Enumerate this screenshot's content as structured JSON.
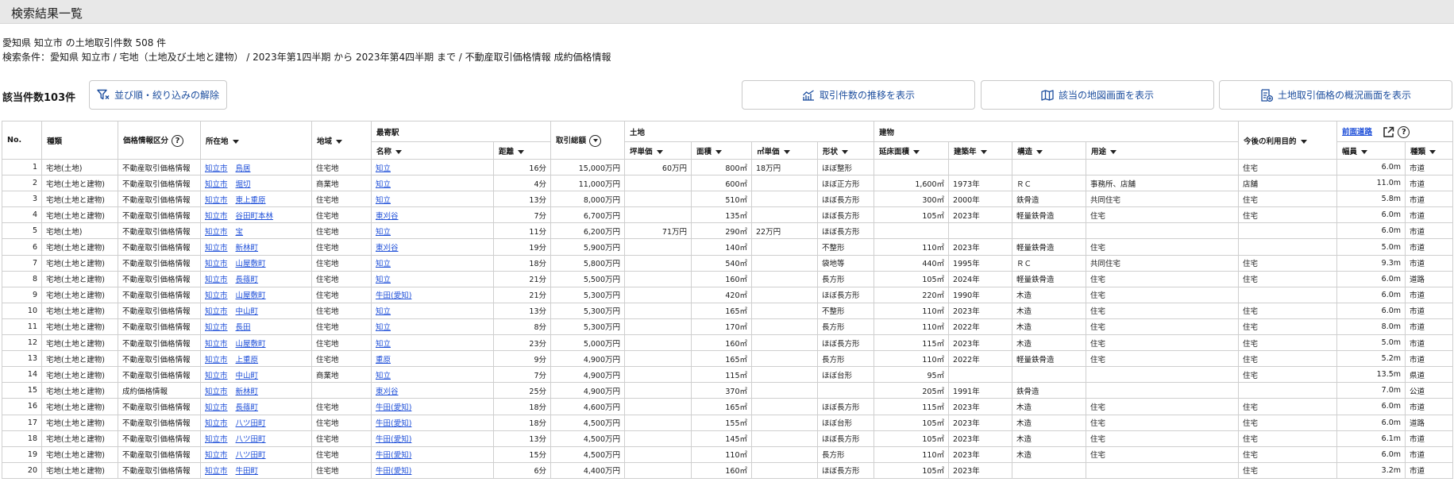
{
  "page": {
    "title": "検索結果一覧"
  },
  "summary": {
    "line1": "愛知県 知立市 の土地取引件数 508 件",
    "line2": "検索条件：愛知県 知立市 / 宅地（土地及び土地と建物） / 2023年第1四半期 から 2023年第4四半期 まで / 不動産取引価格情報 成約価格情報"
  },
  "toolbar": {
    "hit_count": "該当件数103件",
    "reset_label": "並び順・絞り込みの解除",
    "trend_label": "取引件数の推移を表示",
    "map_label": "該当の地図画面を表示",
    "overview_label": "土地取引価格の概況画面を表示"
  },
  "colors": {
    "link": "#1d4ed8",
    "button_text": "#1d4e9e",
    "header_bg": "#e8e8e8",
    "border": "#cfcfcf"
  },
  "table": {
    "groups": {
      "station": "最寄駅",
      "land": "土地",
      "building": "建物",
      "road_link": "前面道路"
    },
    "headers": {
      "no": "No.",
      "kind": "種類",
      "price_cat": "価格情報区分",
      "location": "所在地",
      "area": "地域",
      "station_name": "名称",
      "distance": "距離",
      "total": "取引総額",
      "tsubo": "坪単価",
      "land_area": "面積",
      "sqm": "㎡単価",
      "shape": "形状",
      "floor_area": "延床面積",
      "year": "建築年",
      "structure": "構造",
      "use": "用途",
      "future": "今後の利用目的",
      "width": "幅員",
      "road_kind": "種類"
    },
    "rows": [
      {
        "no": "1",
        "kind": "宅地(土地)",
        "cat": "不動産取引価格情報",
        "city": "知立市",
        "town": "鳥居",
        "area": "住宅地",
        "station": "知立",
        "dist": "16分",
        "total": "15,000万円",
        "tsubo": "60万円",
        "land": "800㎡",
        "sqm": "18万円",
        "shape": "ほぼ整形",
        "floor": "",
        "year": "",
        "struct": "",
        "use": "",
        "future": "住宅",
        "width": "6.0m",
        "road": "市道"
      },
      {
        "no": "2",
        "kind": "宅地(土地と建物)",
        "cat": "不動産取引価格情報",
        "city": "知立市",
        "town": "堀切",
        "area": "商業地",
        "station": "知立",
        "dist": "4分",
        "total": "11,000万円",
        "tsubo": "",
        "land": "600㎡",
        "sqm": "",
        "shape": "ほぼ正方形",
        "floor": "1,600㎡",
        "year": "1973年",
        "struct": "ＲＣ",
        "use": "事務所、店舗",
        "future": "店舗",
        "width": "11.0m",
        "road": "市道"
      },
      {
        "no": "3",
        "kind": "宅地(土地と建物)",
        "cat": "不動産取引価格情報",
        "city": "知立市",
        "town": "東上重原",
        "area": "住宅地",
        "station": "知立",
        "dist": "13分",
        "total": "8,000万円",
        "tsubo": "",
        "land": "510㎡",
        "sqm": "",
        "shape": "ほぼ長方形",
        "floor": "300㎡",
        "year": "2000年",
        "struct": "鉄骨造",
        "use": "共同住宅",
        "future": "住宅",
        "width": "5.8m",
        "road": "市道"
      },
      {
        "no": "4",
        "kind": "宅地(土地と建物)",
        "cat": "不動産取引価格情報",
        "city": "知立市",
        "town": "谷田町本林",
        "area": "住宅地",
        "station": "東刈谷",
        "dist": "7分",
        "total": "6,700万円",
        "tsubo": "",
        "land": "135㎡",
        "sqm": "",
        "shape": "ほぼ長方形",
        "floor": "105㎡",
        "year": "2023年",
        "struct": "軽量鉄骨造",
        "use": "住宅",
        "future": "住宅",
        "width": "6.0m",
        "road": "市道"
      },
      {
        "no": "5",
        "kind": "宅地(土地)",
        "cat": "不動産取引価格情報",
        "city": "知立市",
        "town": "宝",
        "area": "住宅地",
        "station": "知立",
        "dist": "11分",
        "total": "6,200万円",
        "tsubo": "71万円",
        "land": "290㎡",
        "sqm": "22万円",
        "shape": "ほぼ長方形",
        "floor": "",
        "year": "",
        "struct": "",
        "use": "",
        "future": "",
        "width": "6.0m",
        "road": "市道"
      },
      {
        "no": "6",
        "kind": "宅地(土地と建物)",
        "cat": "不動産取引価格情報",
        "city": "知立市",
        "town": "新林町",
        "area": "住宅地",
        "station": "東刈谷",
        "dist": "19分",
        "total": "5,900万円",
        "tsubo": "",
        "land": "140㎡",
        "sqm": "",
        "shape": "不整形",
        "floor": "110㎡",
        "year": "2023年",
        "struct": "軽量鉄骨造",
        "use": "住宅",
        "future": "",
        "width": "5.0m",
        "road": "市道"
      },
      {
        "no": "7",
        "kind": "宅地(土地と建物)",
        "cat": "不動産取引価格情報",
        "city": "知立市",
        "town": "山屋敷町",
        "area": "住宅地",
        "station": "知立",
        "dist": "18分",
        "total": "5,800万円",
        "tsubo": "",
        "land": "540㎡",
        "sqm": "",
        "shape": "袋地等",
        "floor": "440㎡",
        "year": "1995年",
        "struct": "ＲＣ",
        "use": "共同住宅",
        "future": "住宅",
        "width": "9.3m",
        "road": "市道"
      },
      {
        "no": "8",
        "kind": "宅地(土地と建物)",
        "cat": "不動産取引価格情報",
        "city": "知立市",
        "town": "長篠町",
        "area": "住宅地",
        "station": "知立",
        "dist": "21分",
        "total": "5,500万円",
        "tsubo": "",
        "land": "160㎡",
        "sqm": "",
        "shape": "長方形",
        "floor": "105㎡",
        "year": "2024年",
        "struct": "軽量鉄骨造",
        "use": "住宅",
        "future": "住宅",
        "width": "6.0m",
        "road": "道路"
      },
      {
        "no": "9",
        "kind": "宅地(土地と建物)",
        "cat": "不動産取引価格情報",
        "city": "知立市",
        "town": "山屋敷町",
        "area": "住宅地",
        "station": "牛田(愛知)",
        "dist": "21分",
        "total": "5,300万円",
        "tsubo": "",
        "land": "420㎡",
        "sqm": "",
        "shape": "ほぼ長方形",
        "floor": "220㎡",
        "year": "1990年",
        "struct": "木造",
        "use": "住宅",
        "future": "",
        "width": "6.0m",
        "road": "市道"
      },
      {
        "no": "10",
        "kind": "宅地(土地と建物)",
        "cat": "不動産取引価格情報",
        "city": "知立市",
        "town": "中山町",
        "area": "住宅地",
        "station": "知立",
        "dist": "13分",
        "total": "5,300万円",
        "tsubo": "",
        "land": "165㎡",
        "sqm": "",
        "shape": "不整形",
        "floor": "110㎡",
        "year": "2023年",
        "struct": "木造",
        "use": "住宅",
        "future": "住宅",
        "width": "6.0m",
        "road": "市道"
      },
      {
        "no": "11",
        "kind": "宅地(土地と建物)",
        "cat": "不動産取引価格情報",
        "city": "知立市",
        "town": "長田",
        "area": "住宅地",
        "station": "知立",
        "dist": "8分",
        "total": "5,300万円",
        "tsubo": "",
        "land": "170㎡",
        "sqm": "",
        "shape": "長方形",
        "floor": "110㎡",
        "year": "2022年",
        "struct": "木造",
        "use": "住宅",
        "future": "住宅",
        "width": "8.0m",
        "road": "市道"
      },
      {
        "no": "12",
        "kind": "宅地(土地と建物)",
        "cat": "不動産取引価格情報",
        "city": "知立市",
        "town": "山屋敷町",
        "area": "住宅地",
        "station": "知立",
        "dist": "23分",
        "total": "5,000万円",
        "tsubo": "",
        "land": "160㎡",
        "sqm": "",
        "shape": "ほぼ長方形",
        "floor": "115㎡",
        "year": "2023年",
        "struct": "木造",
        "use": "住宅",
        "future": "住宅",
        "width": "5.0m",
        "road": "市道"
      },
      {
        "no": "13",
        "kind": "宅地(土地と建物)",
        "cat": "不動産取引価格情報",
        "city": "知立市",
        "town": "上重原",
        "area": "住宅地",
        "station": "重原",
        "dist": "9分",
        "total": "4,900万円",
        "tsubo": "",
        "land": "165㎡",
        "sqm": "",
        "shape": "長方形",
        "floor": "110㎡",
        "year": "2022年",
        "struct": "軽量鉄骨造",
        "use": "住宅",
        "future": "住宅",
        "width": "5.2m",
        "road": "市道"
      },
      {
        "no": "14",
        "kind": "宅地(土地と建物)",
        "cat": "不動産取引価格情報",
        "city": "知立市",
        "town": "中山町",
        "area": "商業地",
        "station": "知立",
        "dist": "7分",
        "total": "4,900万円",
        "tsubo": "",
        "land": "115㎡",
        "sqm": "",
        "shape": "ほぼ台形",
        "floor": "95㎡",
        "year": "",
        "struct": "",
        "use": "",
        "future": "住宅",
        "width": "13.5m",
        "road": "県道"
      },
      {
        "no": "15",
        "kind": "宅地(土地と建物)",
        "cat": "成約価格情報",
        "city": "知立市",
        "town": "新林町",
        "area": "",
        "station": "東刈谷",
        "dist": "25分",
        "total": "4,900万円",
        "tsubo": "",
        "land": "370㎡",
        "sqm": "",
        "shape": "",
        "floor": "205㎡",
        "year": "1991年",
        "struct": "鉄骨造",
        "use": "",
        "future": "",
        "width": "7.0m",
        "road": "公道"
      },
      {
        "no": "16",
        "kind": "宅地(土地と建物)",
        "cat": "不動産取引価格情報",
        "city": "知立市",
        "town": "長篠町",
        "area": "住宅地",
        "station": "牛田(愛知)",
        "dist": "18分",
        "total": "4,600万円",
        "tsubo": "",
        "land": "165㎡",
        "sqm": "",
        "shape": "ほぼ長方形",
        "floor": "115㎡",
        "year": "2023年",
        "struct": "木造",
        "use": "住宅",
        "future": "住宅",
        "width": "6.0m",
        "road": "市道"
      },
      {
        "no": "17",
        "kind": "宅地(土地と建物)",
        "cat": "不動産取引価格情報",
        "city": "知立市",
        "town": "八ツ田町",
        "area": "住宅地",
        "station": "牛田(愛知)",
        "dist": "18分",
        "total": "4,500万円",
        "tsubo": "",
        "land": "155㎡",
        "sqm": "",
        "shape": "ほぼ台形",
        "floor": "105㎡",
        "year": "2023年",
        "struct": "木造",
        "use": "住宅",
        "future": "住宅",
        "width": "6.0m",
        "road": "道路"
      },
      {
        "no": "18",
        "kind": "宅地(土地と建物)",
        "cat": "不動産取引価格情報",
        "city": "知立市",
        "town": "八ツ田町",
        "area": "住宅地",
        "station": "牛田(愛知)",
        "dist": "13分",
        "total": "4,500万円",
        "tsubo": "",
        "land": "145㎡",
        "sqm": "",
        "shape": "ほぼ長方形",
        "floor": "105㎡",
        "year": "2023年",
        "struct": "木造",
        "use": "住宅",
        "future": "住宅",
        "width": "6.1m",
        "road": "市道"
      },
      {
        "no": "19",
        "kind": "宅地(土地と建物)",
        "cat": "不動産取引価格情報",
        "city": "知立市",
        "town": "八ツ田町",
        "area": "住宅地",
        "station": "牛田(愛知)",
        "dist": "15分",
        "total": "4,500万円",
        "tsubo": "",
        "land": "110㎡",
        "sqm": "",
        "shape": "長方形",
        "floor": "110㎡",
        "year": "2023年",
        "struct": "木造",
        "use": "住宅",
        "future": "住宅",
        "width": "6.0m",
        "road": "市道"
      },
      {
        "no": "20",
        "kind": "宅地(土地と建物)",
        "cat": "不動産取引価格情報",
        "city": "知立市",
        "town": "牛田町",
        "area": "住宅地",
        "station": "牛田(愛知)",
        "dist": "6分",
        "total": "4,400万円",
        "tsubo": "",
        "land": "160㎡",
        "sqm": "",
        "shape": "ほぼ長方形",
        "floor": "105㎡",
        "year": "2023年",
        "struct": "",
        "use": "",
        "future": "住宅",
        "width": "3.2m",
        "road": "市道"
      }
    ]
  }
}
